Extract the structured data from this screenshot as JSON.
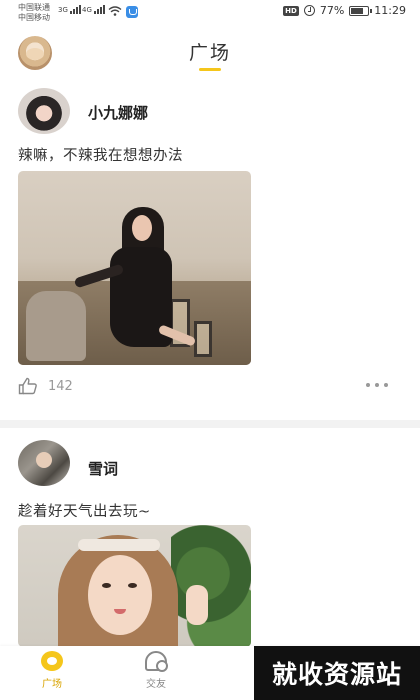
{
  "status_bar": {
    "carrier_1": "中国联通",
    "carrier_2": "中国移动",
    "network_1": "3G",
    "network_2": "4G",
    "hd_badge": "HD",
    "battery_percent": "77%",
    "time": "11:29",
    "icons": [
      "signal-icon",
      "wifi-icon",
      "app-notification-icon",
      "alarm-icon",
      "battery-icon"
    ]
  },
  "header": {
    "title": "广场",
    "accent_color": "#f5c61b"
  },
  "posts": [
    {
      "username": "小九娜娜",
      "text": "辣嘛，不辣我在想想办法",
      "likes": "142"
    },
    {
      "username": "雪词",
      "text": "趁着好天气出去玩~"
    }
  ],
  "tab_bar": {
    "tabs": [
      {
        "label": "广场",
        "icon": "square-icon",
        "active": true
      },
      {
        "label": "交友",
        "icon": "friends-icon",
        "active": false
      }
    ],
    "active_color": "#d9a400"
  },
  "watermark": {
    "text": "就收资源站"
  }
}
